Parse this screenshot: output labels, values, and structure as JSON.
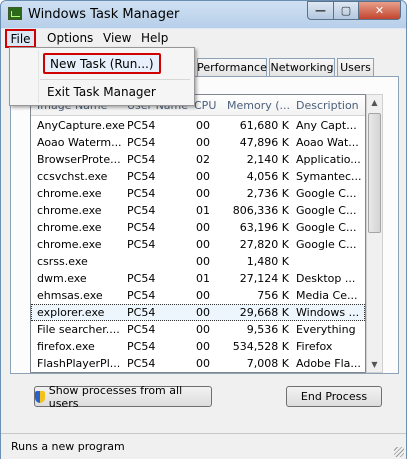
{
  "window": {
    "title": "Windows Task Manager",
    "minimize_glyph": "—",
    "maximize_glyph": "▢",
    "close_glyph": "✕"
  },
  "menu": {
    "file": "File",
    "options": "Options",
    "view": "View",
    "help": "Help"
  },
  "file_menu": {
    "new_task": "New Task (Run...)",
    "exit": "Exit Task Manager"
  },
  "tabs": [
    "Performance",
    "Networking",
    "Users"
  ],
  "columns": {
    "name": "Image Name",
    "user": "User Name",
    "cpu": "CPU",
    "memory": "Memory (...",
    "description": "Description"
  },
  "processes": [
    {
      "name": "AnyCapture.exe",
      "user": "PC54",
      "cpu": "00",
      "memory": "61,680 K",
      "description": "Any Capt..."
    },
    {
      "name": "Aoao Waterm...",
      "user": "PC54",
      "cpu": "00",
      "memory": "47,896 K",
      "description": "Aoao Wat..."
    },
    {
      "name": "BrowserProte...",
      "user": "PC54",
      "cpu": "02",
      "memory": "2,140 K",
      "description": "Applicatio..."
    },
    {
      "name": "ccsvchst.exe",
      "user": "PC54",
      "cpu": "00",
      "memory": "4,056 K",
      "description": "Symantec..."
    },
    {
      "name": "chrome.exe",
      "user": "PC54",
      "cpu": "00",
      "memory": "2,736 K",
      "description": "Google C..."
    },
    {
      "name": "chrome.exe",
      "user": "PC54",
      "cpu": "01",
      "memory": "806,336 K",
      "description": "Google C..."
    },
    {
      "name": "chrome.exe",
      "user": "PC54",
      "cpu": "00",
      "memory": "63,196 K",
      "description": "Google C..."
    },
    {
      "name": "chrome.exe",
      "user": "PC54",
      "cpu": "00",
      "memory": "27,820 K",
      "description": "Google C..."
    },
    {
      "name": "csrss.exe",
      "user": "",
      "cpu": "00",
      "memory": "1,480 K",
      "description": ""
    },
    {
      "name": "dwm.exe",
      "user": "PC54",
      "cpu": "01",
      "memory": "27,124 K",
      "description": "Desktop ..."
    },
    {
      "name": "ehmsas.exe",
      "user": "PC54",
      "cpu": "00",
      "memory": "756 K",
      "description": "Media Ce..."
    },
    {
      "name": "explorer.exe",
      "user": "PC54",
      "cpu": "00",
      "memory": "29,668 K",
      "description": "Windows ..."
    },
    {
      "name": "File searcher....",
      "user": "PC54",
      "cpu": "00",
      "memory": "9,536 K",
      "description": "Everything"
    },
    {
      "name": "firefox.exe",
      "user": "PC54",
      "cpu": "00",
      "memory": "534,528 K",
      "description": "Firefox"
    },
    {
      "name": "FlashPlayerPl...",
      "user": "PC54",
      "cpu": "00",
      "memory": "7,008 K",
      "description": "Adobe Fla..."
    }
  ],
  "buttons": {
    "show_all": "Show processes from all users",
    "end_process": "End Process"
  },
  "status": "Runs a new program",
  "scroll": {
    "up": "▲",
    "down": "▼"
  }
}
